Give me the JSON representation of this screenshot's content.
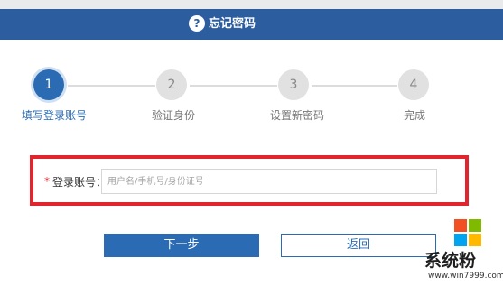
{
  "header": {
    "icon": "question-circle-icon",
    "icon_glyph": "?",
    "title": "忘记密码",
    "bg_color": "#2b5d9f"
  },
  "steps": [
    {
      "number": "1",
      "label": "填写登录账号",
      "active": true
    },
    {
      "number": "2",
      "label": "验证身份",
      "active": false
    },
    {
      "number": "3",
      "label": "设置新密码",
      "active": false
    },
    {
      "number": "4",
      "label": "完成",
      "active": false
    }
  ],
  "form": {
    "required_mark": "*",
    "account_label": "登录账号：",
    "account_value": "",
    "account_placeholder": "用户名/手机号/身份证号",
    "highlight_color": "#e0252f"
  },
  "buttons": {
    "next_label": "下一步",
    "back_label": "返回"
  },
  "watermark": {
    "text": "系统粉",
    "url": "www.win7999.com",
    "logo": "windows-logo"
  }
}
